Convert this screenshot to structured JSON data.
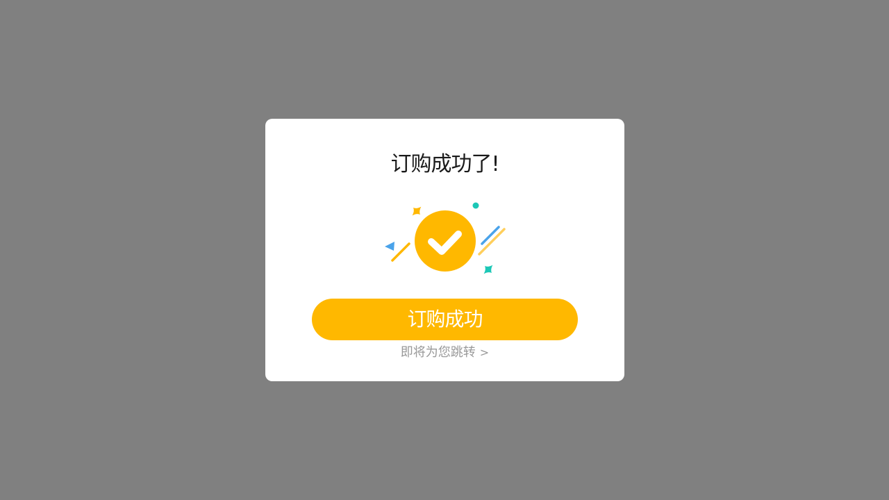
{
  "dialog": {
    "title": "订购成功了!",
    "illustration_icon": "check-circle-celebration-icon",
    "primary_button_label": "订购成功",
    "redirect_text": "即将为您跳转",
    "redirect_chevron": ">"
  },
  "colors": {
    "overlay": "#808080",
    "accent": "#ffb800",
    "teal": "#1cc7b6",
    "blue": "#4aa3ea",
    "muted_text": "#999999"
  }
}
